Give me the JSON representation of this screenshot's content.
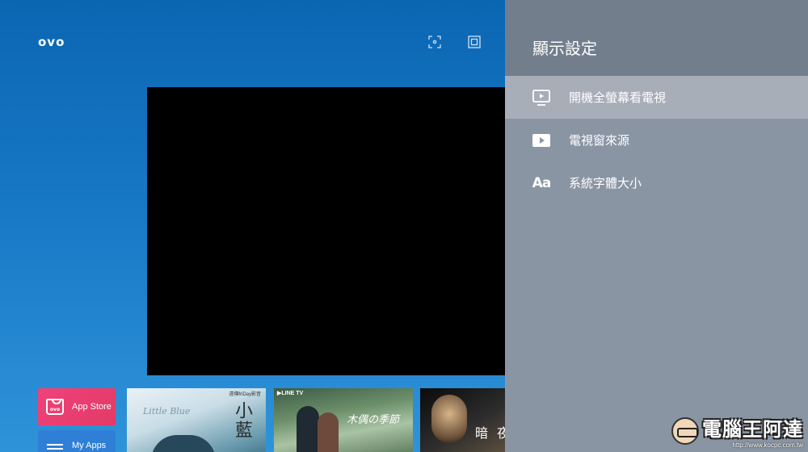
{
  "launcher": {
    "brand": "ovo",
    "top_icons": [
      "screen-fit-icon",
      "picture-in-picture-icon"
    ],
    "apps": [
      {
        "label": "App Store",
        "icon": "store-bag-icon",
        "icon_text": "ovo"
      },
      {
        "label": "My Apps",
        "icon": "list-icon"
      }
    ],
    "posters": [
      {
        "provider": "遠傳friDay影音",
        "title": "小藍",
        "script": "Little Blue"
      },
      {
        "provider": "▶LINE TV",
        "title": "木偶の季節"
      },
      {
        "title": "暗 夜"
      }
    ]
  },
  "settings_panel": {
    "title": "顯示設定",
    "items": [
      {
        "label": "開機全螢幕看電視",
        "icon": "tv-play-icon",
        "selected": true
      },
      {
        "label": "電視窗來源",
        "icon": "play-icon",
        "selected": false
      },
      {
        "label": "系統字體大小",
        "icon": "font-size-icon",
        "icon_text": "Aa",
        "selected": false
      }
    ]
  },
  "watermark": {
    "title": "電腦王阿達",
    "url": "http://www.kocpc.com.tw"
  },
  "colors": {
    "launcher_top": "#0b66b2",
    "panel_bg": "#8a95a3",
    "panel_header": "#737e8d",
    "selected_item": "#a7aeb8",
    "app_store": "#f0427a"
  }
}
